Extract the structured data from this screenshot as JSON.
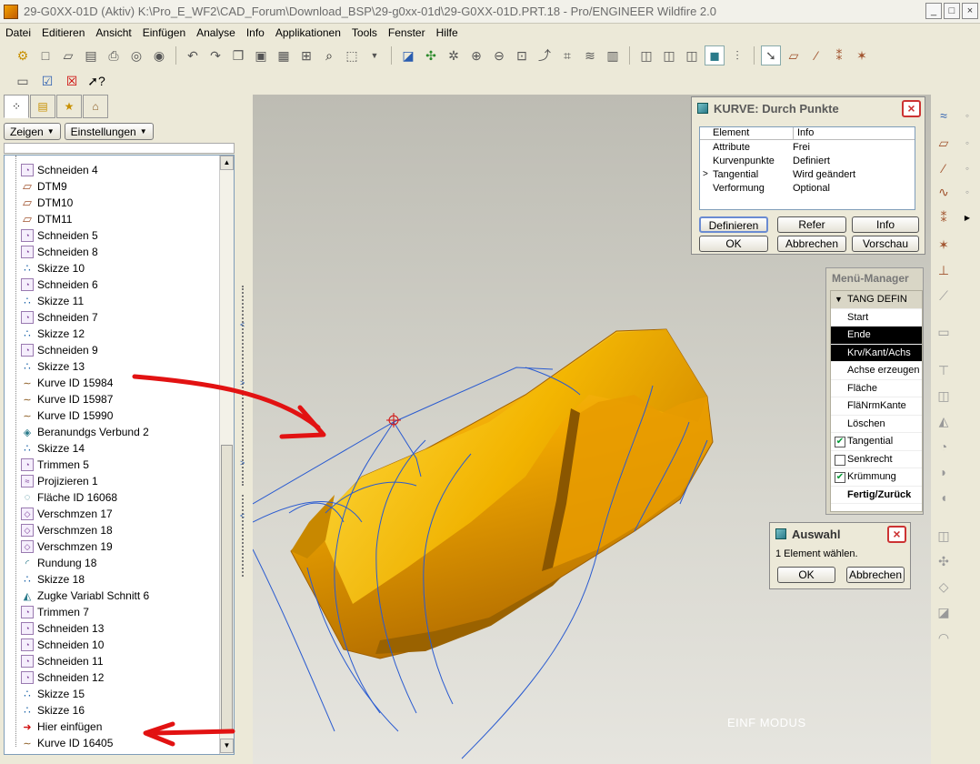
{
  "window": {
    "title": "29-G0XX-01D (Aktiv) K:\\Pro_E_WF2\\CAD_Forum\\Download_BSP\\29-g0xx-01d\\29-G0XX-01D.PRT.18 - Pro/ENGINEER Wildfire 2.0"
  },
  "menubar": [
    "Datei",
    "Editieren",
    "Ansicht",
    "Einfügen",
    "Analyse",
    "Info",
    "Applikationen",
    "Tools",
    "Fenster",
    "Hilfe"
  ],
  "panel": {
    "show_label": "Zeigen",
    "settings_label": "Einstellungen",
    "tree_items": [
      {
        "label": "Schneiden 4",
        "icon": "cut-icon"
      },
      {
        "label": "DTM9",
        "icon": "datum-plane-icon"
      },
      {
        "label": "DTM10",
        "icon": "datum-plane-icon"
      },
      {
        "label": "DTM11",
        "icon": "datum-plane-icon"
      },
      {
        "label": "Schneiden 5",
        "icon": "cut-icon"
      },
      {
        "label": "Schneiden 8",
        "icon": "cut-icon"
      },
      {
        "label": "Skizze 10",
        "icon": "sketch-icon"
      },
      {
        "label": "Schneiden 6",
        "icon": "cut-icon"
      },
      {
        "label": "Skizze 11",
        "icon": "sketch-icon"
      },
      {
        "label": "Schneiden 7",
        "icon": "cut-icon"
      },
      {
        "label": "Skizze 12",
        "icon": "sketch-icon"
      },
      {
        "label": "Schneiden 9",
        "icon": "cut-icon"
      },
      {
        "label": "Skizze 13",
        "icon": "sketch-icon"
      },
      {
        "label": "Kurve ID 15984",
        "icon": "curve-icon"
      },
      {
        "label": "Kurve ID 15987",
        "icon": "curve-icon"
      },
      {
        "label": "Kurve ID 15990",
        "icon": "curve-icon"
      },
      {
        "label": "Beranundgs Verbund 2",
        "icon": "blend-icon"
      },
      {
        "label": "Skizze 14",
        "icon": "sketch-icon"
      },
      {
        "label": "Trimmen 5",
        "icon": "cut-icon"
      },
      {
        "label": "Projizieren 1",
        "icon": "project-icon"
      },
      {
        "label": "Fläche ID 16068",
        "icon": "surface-icon"
      },
      {
        "label": "Verschmzen 17",
        "icon": "merge-icon"
      },
      {
        "label": "Verschmzen 18",
        "icon": "merge-icon"
      },
      {
        "label": "Verschmzen 19",
        "icon": "merge-icon"
      },
      {
        "label": "Rundung 18",
        "icon": "round-icon"
      },
      {
        "label": "Skizze 18",
        "icon": "sketch-icon"
      },
      {
        "label": "Zugke Variabl Schnitt 6",
        "icon": "sweep-icon"
      },
      {
        "label": "Trimmen 7",
        "icon": "cut-icon"
      },
      {
        "label": "Schneiden 13",
        "icon": "cut-icon"
      },
      {
        "label": "Schneiden 10",
        "icon": "cut-icon"
      },
      {
        "label": "Schneiden 11",
        "icon": "cut-icon"
      },
      {
        "label": "Schneiden 12",
        "icon": "cut-icon"
      },
      {
        "label": "Skizze 15",
        "icon": "sketch-icon"
      },
      {
        "label": "Skizze 16",
        "icon": "sketch-icon"
      },
      {
        "label": "Hier einfügen",
        "icon": "insert-arrow-icon"
      },
      {
        "label": "Kurve ID 16405",
        "icon": "curve-icon"
      }
    ]
  },
  "viewport": {
    "mode_label": "EINF MODUS"
  },
  "kurve_dialog": {
    "title": "KURVE: Durch Punkte",
    "col_element": "Element",
    "col_info": "Info",
    "rows": [
      {
        "element": "Attribute",
        "info": "Frei",
        "marker": ""
      },
      {
        "element": "Kurvenpunkte",
        "info": "Definiert",
        "marker": ""
      },
      {
        "element": "Tangential",
        "info": "Wird geändert",
        "marker": ">"
      },
      {
        "element": "Verformung",
        "info": "Optional",
        "marker": ""
      }
    ],
    "define_label": "Definieren",
    "refer_label": "Refer",
    "info_label": "Info",
    "ok_label": "OK",
    "cancel_label": "Abbrechen",
    "preview_label": "Vorschau"
  },
  "menu_manager": {
    "title": "Menü-Manager",
    "header": "TANG DEFIN",
    "items": [
      "Start",
      "Ende",
      "Krv/Kant/Achs",
      "Achse erzeugen",
      "Fläche",
      "FläNrmKante",
      "Löschen"
    ],
    "selected": [
      "Ende",
      "Krv/Kant/Achs"
    ],
    "checkboxes": [
      {
        "label": "Tangential",
        "checked": true
      },
      {
        "label": "Senkrecht",
        "checked": false
      },
      {
        "label": "Krümmung",
        "checked": true
      }
    ],
    "done_label": "Fertig/Zurück"
  },
  "auswahl_dialog": {
    "title": "Auswahl",
    "message": "1 Element wählen.",
    "ok_label": "OK",
    "cancel_label": "Abbrechen"
  },
  "colors": {
    "model": "#f2b500",
    "annotation": "#e21212",
    "curve": "#2255cc"
  }
}
